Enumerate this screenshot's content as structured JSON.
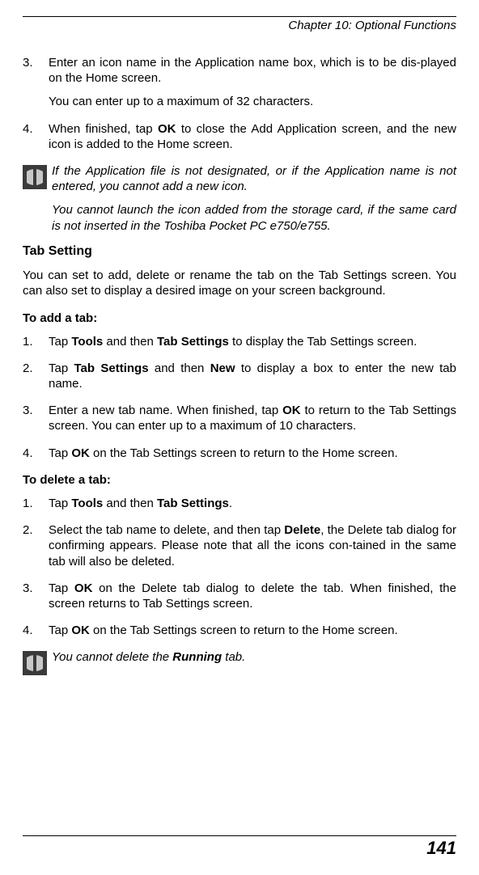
{
  "header": {
    "chapter": "Chapter 10: Optional Functions"
  },
  "steps_top": [
    {
      "num": "3.",
      "text_parts": [
        "Enter an icon name in the Application name box, which is to be dis-played on the Home screen."
      ],
      "sub": "You can enter up to a maximum of 32 characters."
    },
    {
      "num": "4.",
      "text_parts": [
        "When finished, tap ",
        "OK",
        " to close the Add Application screen, and the new icon is  added to the Home screen."
      ]
    }
  ],
  "note1": {
    "p1": "If the Application file is not designated, or if the Application name is not entered, you cannot add a new icon.",
    "p2": "You cannot launch the icon added from the storage card, if the same card is not  inserted in the Toshiba Pocket PC e750/e755."
  },
  "section": {
    "heading": "Tab Setting",
    "intro": "You can set to add, delete or rename the tab on the Tab Settings screen. You can also set to display a desired image on your screen background."
  },
  "addtab": {
    "heading": "To add a  tab:",
    "items": [
      {
        "num": "1.",
        "parts": [
          "Tap ",
          "Tools",
          " and then ",
          "Tab Settings",
          " to display the Tab Settings screen."
        ]
      },
      {
        "num": "2.",
        "parts": [
          "Tap ",
          "Tab Settings",
          " and then ",
          "New",
          " to display a box to enter the new tab name."
        ]
      },
      {
        "num": "3.",
        "parts": [
          "Enter a new tab name. When finished, tap ",
          "OK",
          " to return to the Tab Settings screen. You can enter up to a maximum of 10 characters."
        ]
      },
      {
        "num": "4.",
        "parts": [
          "Tap ",
          "OK",
          " on the Tab Settings screen to return to the Home screen."
        ]
      }
    ]
  },
  "deltab": {
    "heading": "To delete a tab:",
    "items": [
      {
        "num": "1.",
        "parts": [
          "Tap ",
          "Tools",
          " and then ",
          "Tab Settings",
          "."
        ]
      },
      {
        "num": "2.",
        "parts": [
          "Select the tab name to delete, and then tap ",
          "Delete",
          ", the Delete tab dialog for confirming appears. Please note that all the icons con-tained in the same tab will also be deleted."
        ]
      },
      {
        "num": "3.",
        "parts": [
          "Tap ",
          "OK",
          " on the Delete tab dialog to delete the tab. When finished, the screen returns to Tab Settings screen."
        ]
      },
      {
        "num": "4.",
        "parts": [
          "Tap ",
          "OK",
          " on the Tab Settings screen to return to the Home screen."
        ]
      }
    ]
  },
  "note2": {
    "pre": "You cannot delete the ",
    "bold": "Running",
    "post": " tab."
  },
  "footer": {
    "page": "141"
  }
}
